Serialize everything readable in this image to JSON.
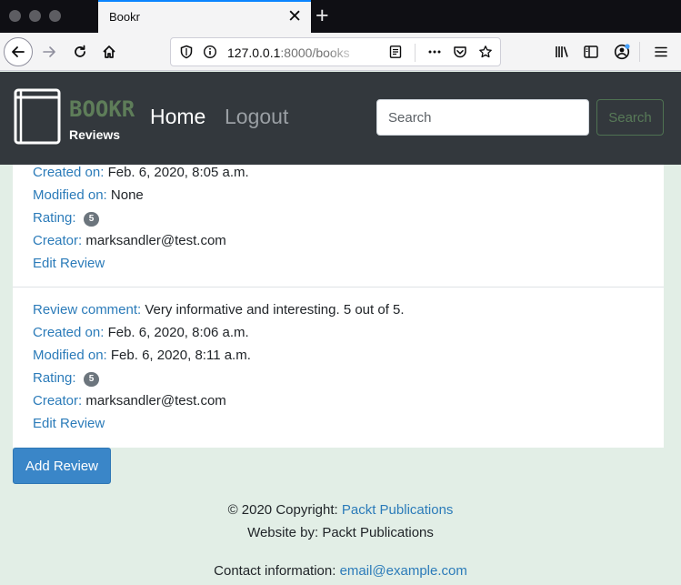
{
  "browser": {
    "tab_title": "Bookr",
    "tab_close": "✕",
    "new_tab": "+",
    "url_host": "127.0.0.1",
    "url_rest": ":8000/books",
    "accent": "#0a84ff"
  },
  "navbar": {
    "brand_name": "BOOKR",
    "brand_sub": "Reviews",
    "nav_home": "Home",
    "nav_logout": "Logout",
    "search_placeholder": "Search",
    "search_button": "Search",
    "background": "#33383d"
  },
  "reviews": [
    {
      "created_label": "Created on:",
      "created_value": "Feb. 6, 2020, 8:05 a.m.",
      "modified_label": "Modified on:",
      "modified_value": "None",
      "rating_label": "Rating:",
      "rating_value": "5",
      "creator_label": "Creator:",
      "creator_value": "marksandler@test.com",
      "edit_link": "Edit Review"
    },
    {
      "comment_label": "Review comment:",
      "comment_value": "Very informative and interesting. 5 out of 5.",
      "created_label": "Created on:",
      "created_value": "Feb. 6, 2020, 8:06 a.m.",
      "modified_label": "Modified on:",
      "modified_value": "Feb. 6, 2020, 8:11 a.m.",
      "rating_label": "Rating:",
      "rating_value": "5",
      "creator_label": "Creator:",
      "creator_value": "marksandler@test.com",
      "edit_link": "Edit Review"
    }
  ],
  "add_review_button": "Add Review",
  "footer": {
    "copyright_prefix": "© 2020 Copyright:",
    "copyright_link": "Packt Publications",
    "website_by": "Website by: Packt Publications",
    "contact_prefix": "Contact information:",
    "contact_email": "email@example.com"
  },
  "icons": [
    "back-icon",
    "forward-icon",
    "reload-icon",
    "home-icon",
    "shield-icon",
    "info-icon",
    "reader-view-icon",
    "more-icon",
    "pocket-icon",
    "star-icon",
    "library-icon",
    "sidebar-icon",
    "account-icon",
    "menu-icon",
    "book-logo-icon"
  ]
}
